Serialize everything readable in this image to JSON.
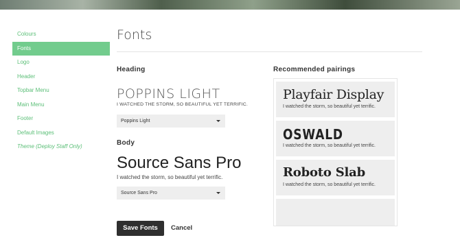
{
  "sidebar": {
    "items": [
      {
        "label": "Colours",
        "active": false
      },
      {
        "label": "Fonts",
        "active": true
      },
      {
        "label": "Logo",
        "active": false
      },
      {
        "label": "Header",
        "active": false
      },
      {
        "label": "Topbar Menu",
        "active": false
      },
      {
        "label": "Main Menu",
        "active": false
      },
      {
        "label": "Footer",
        "active": false
      },
      {
        "label": "Default Images",
        "active": false
      },
      {
        "label": "Theme (Deploy Staff Only)",
        "active": false
      }
    ]
  },
  "main": {
    "title": "Fonts",
    "heading": {
      "section_label": "Heading",
      "sample_name": "POPPINS LIGHT",
      "sample_text": "I WATCHED THE STORM, SO BEAUTIFUL YET TERRIFIC.",
      "select_value": "Poppins Light"
    },
    "body": {
      "section_label": "Body",
      "sample_name": "Source Sans Pro",
      "sample_text": "I watched the storm, so beautiful yet terrific.",
      "select_value": "Source Sans Pro"
    },
    "actions": {
      "save_label": "Save Fonts",
      "cancel_label": "Cancel"
    }
  },
  "pairings": {
    "title": "Recommended pairings",
    "items": [
      {
        "name": "Playfair Display",
        "sample": "I watched the storm, so beautiful yet terrific."
      },
      {
        "name": "OSWALD",
        "sample": "I watched the storm, so beautiful yet terrific."
      },
      {
        "name": "Roboto Slab",
        "sample": "I watched the storm, so beautiful yet terrific."
      },
      {
        "name": "",
        "sample": ""
      }
    ]
  },
  "colors": {
    "accent": "#72cc8d",
    "accent_text": "#5cbf78",
    "button_dark": "#2f2f2f"
  }
}
